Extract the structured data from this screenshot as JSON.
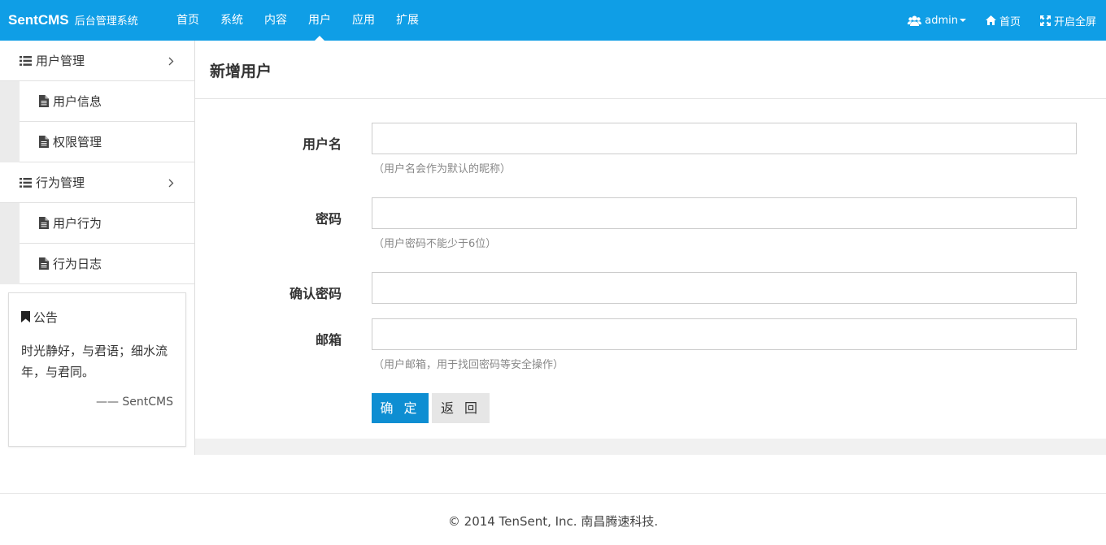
{
  "header": {
    "brand": "SentCMS",
    "brand_sub": "后台管理系统",
    "nav": [
      {
        "label": "首页"
      },
      {
        "label": "系统"
      },
      {
        "label": "内容"
      },
      {
        "label": "用户",
        "active": true
      },
      {
        "label": "应用"
      },
      {
        "label": "扩展"
      }
    ],
    "user_label": "admin",
    "home_label": "首页",
    "fullscreen_label": "开启全屏",
    "bar_color": "#0f9ee6"
  },
  "sidebar": {
    "groups": [
      {
        "label": "用户管理",
        "icon": "list-icon",
        "items": [
          {
            "label": "用户信息",
            "icon": "file-icon"
          },
          {
            "label": "权限管理",
            "icon": "file-icon"
          }
        ]
      },
      {
        "label": "行为管理",
        "icon": "list-icon",
        "items": [
          {
            "label": "用户行为",
            "icon": "file-icon"
          },
          {
            "label": "行为日志",
            "icon": "file-icon"
          }
        ]
      }
    ],
    "notice": {
      "title": "公告",
      "icon": "bookmark-icon",
      "text": "时光静好，与君语；细水流年，与君同。",
      "sign": "—— SentCMS"
    }
  },
  "main": {
    "title": "新增用户",
    "fields": {
      "username": {
        "label": "用户名",
        "value": "",
        "help": "（用户名会作为默认的昵称）"
      },
      "password": {
        "label": "密码",
        "value": "",
        "help": "（用户密码不能少于6位）"
      },
      "confirm": {
        "label": "确认密码",
        "value": ""
      },
      "email": {
        "label": "邮箱",
        "value": "",
        "help": "（用户邮箱，用于找回密码等安全操作）"
      }
    },
    "submit_label": "确 定",
    "back_label": "返 回",
    "primary_color": "#0e8ed2"
  },
  "footer": {
    "text": "© 2014 TenSent, Inc. 南昌腾速科技."
  }
}
